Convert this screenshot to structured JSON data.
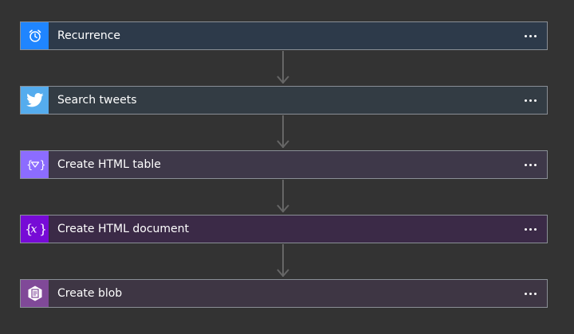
{
  "steps": [
    {
      "label": "Recurrence",
      "icon": "alarm-clock-icon",
      "icon_bg": "#1f85ff",
      "bg": "#2d3a4a"
    },
    {
      "label": "Search tweets",
      "icon": "twitter-bird-icon",
      "icon_bg": "#55acee",
      "bg": "#333c44"
    },
    {
      "label": "Create HTML table",
      "icon": "variables-filter-icon",
      "icon_bg": "#8c6cff",
      "bg": "#3e3849"
    },
    {
      "label": "Create HTML document",
      "icon": "variable-x-icon",
      "icon_bg": "#770bd6",
      "bg": "#3b2a47"
    },
    {
      "label": "Create blob",
      "icon": "blob-storage-icon",
      "icon_bg": "#804998",
      "bg": "#3e3644"
    }
  ],
  "colors": {
    "canvas": "#333333",
    "border": "#8a8f96",
    "connector": "#666666"
  }
}
